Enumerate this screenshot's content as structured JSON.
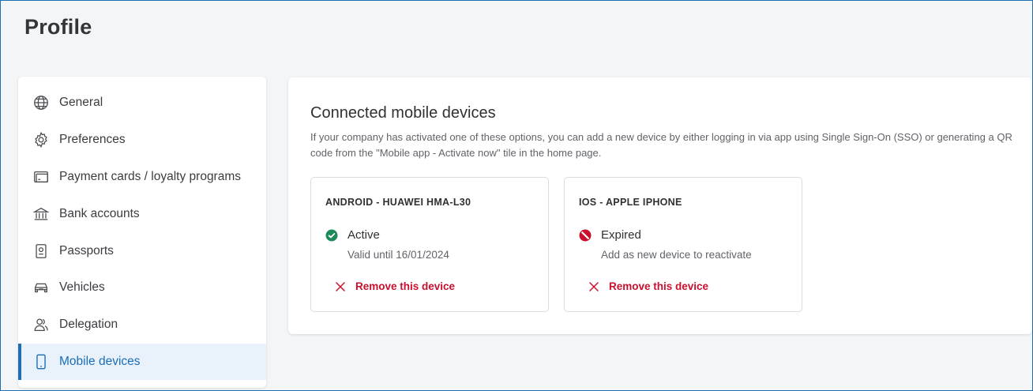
{
  "page": {
    "title": "Profile"
  },
  "sidebar": {
    "items": [
      {
        "label": "General",
        "icon": "globe-icon",
        "active": false
      },
      {
        "label": "Preferences",
        "icon": "gear-icon",
        "active": false
      },
      {
        "label": "Payment cards / loyalty programs",
        "icon": "credit-card-icon",
        "active": false
      },
      {
        "label": "Bank accounts",
        "icon": "bank-icon",
        "active": false
      },
      {
        "label": "Passports",
        "icon": "passport-icon",
        "active": false
      },
      {
        "label": "Vehicles",
        "icon": "car-icon",
        "active": false
      },
      {
        "label": "Delegation",
        "icon": "users-icon",
        "active": false
      },
      {
        "label": "Mobile devices",
        "icon": "smartphone-icon",
        "active": true
      }
    ]
  },
  "main": {
    "title": "Connected mobile devices",
    "description": "If your company has activated one of these options, you can add a new device by either logging in via app using Single Sign-On (SSO) or generating a QR code from the \"Mobile app - Activate now\" tile in the home page.",
    "devices": [
      {
        "name": "ANDROID - HUAWEI HMA-L30",
        "status": "Active",
        "status_icon": "check-circle-icon",
        "detail": "Valid until 16/01/2024",
        "remove_label": "Remove this device"
      },
      {
        "name": "IOS - APPLE IPHONE",
        "status": "Expired",
        "status_icon": "no-entry-icon",
        "detail": "Add as new device to reactivate",
        "remove_label": "Remove this device"
      }
    ]
  },
  "colors": {
    "accent": "#1b6db8",
    "active_green": "#1e8a5a",
    "expired_red": "#c8102e",
    "remove_red": "#c8102e"
  }
}
